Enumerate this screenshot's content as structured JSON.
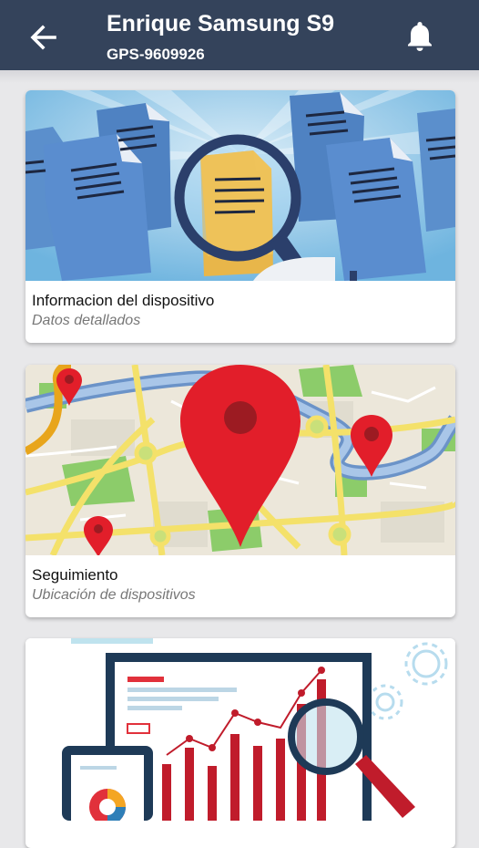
{
  "header": {
    "title": "Enrique Samsung S9",
    "subtitle": "GPS-9609926",
    "back_icon": "arrow-left-icon",
    "notification_icon": "bell-icon",
    "background": "#34435b"
  },
  "cards": [
    {
      "title": "Informacion del dispositivo",
      "subtitle": "Datos detallados",
      "image": "documents-magnifier-illustration"
    },
    {
      "title": "Seguimiento",
      "subtitle": "Ubicación de dispositivos",
      "image": "map-pins-illustration"
    },
    {
      "title": "",
      "subtitle": "",
      "image": "reports-chart-illustration"
    }
  ]
}
